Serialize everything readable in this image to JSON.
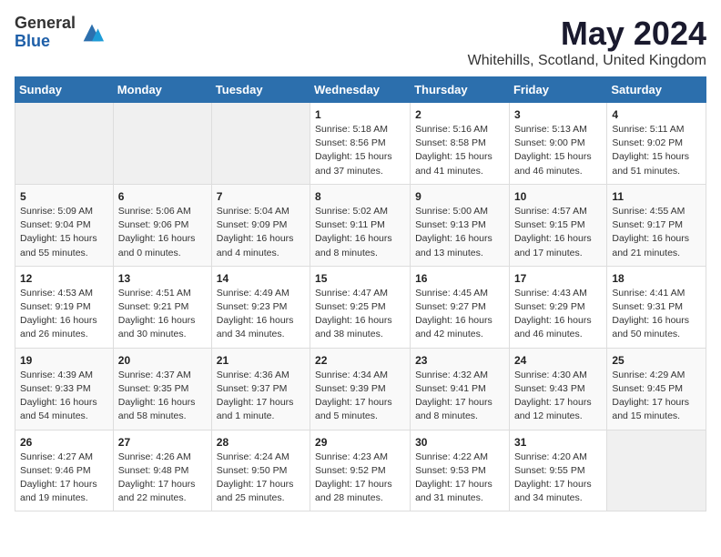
{
  "logo": {
    "general": "General",
    "blue": "Blue"
  },
  "title": "May 2024",
  "location": "Whitehills, Scotland, United Kingdom",
  "weekdays": [
    "Sunday",
    "Monday",
    "Tuesday",
    "Wednesday",
    "Thursday",
    "Friday",
    "Saturday"
  ],
  "weeks": [
    [
      {
        "day": "",
        "info": ""
      },
      {
        "day": "",
        "info": ""
      },
      {
        "day": "",
        "info": ""
      },
      {
        "day": "1",
        "info": "Sunrise: 5:18 AM\nSunset: 8:56 PM\nDaylight: 15 hours\nand 37 minutes."
      },
      {
        "day": "2",
        "info": "Sunrise: 5:16 AM\nSunset: 8:58 PM\nDaylight: 15 hours\nand 41 minutes."
      },
      {
        "day": "3",
        "info": "Sunrise: 5:13 AM\nSunset: 9:00 PM\nDaylight: 15 hours\nand 46 minutes."
      },
      {
        "day": "4",
        "info": "Sunrise: 5:11 AM\nSunset: 9:02 PM\nDaylight: 15 hours\nand 51 minutes."
      }
    ],
    [
      {
        "day": "5",
        "info": "Sunrise: 5:09 AM\nSunset: 9:04 PM\nDaylight: 15 hours\nand 55 minutes."
      },
      {
        "day": "6",
        "info": "Sunrise: 5:06 AM\nSunset: 9:06 PM\nDaylight: 16 hours\nand 0 minutes."
      },
      {
        "day": "7",
        "info": "Sunrise: 5:04 AM\nSunset: 9:09 PM\nDaylight: 16 hours\nand 4 minutes."
      },
      {
        "day": "8",
        "info": "Sunrise: 5:02 AM\nSunset: 9:11 PM\nDaylight: 16 hours\nand 8 minutes."
      },
      {
        "day": "9",
        "info": "Sunrise: 5:00 AM\nSunset: 9:13 PM\nDaylight: 16 hours\nand 13 minutes."
      },
      {
        "day": "10",
        "info": "Sunrise: 4:57 AM\nSunset: 9:15 PM\nDaylight: 16 hours\nand 17 minutes."
      },
      {
        "day": "11",
        "info": "Sunrise: 4:55 AM\nSunset: 9:17 PM\nDaylight: 16 hours\nand 21 minutes."
      }
    ],
    [
      {
        "day": "12",
        "info": "Sunrise: 4:53 AM\nSunset: 9:19 PM\nDaylight: 16 hours\nand 26 minutes."
      },
      {
        "day": "13",
        "info": "Sunrise: 4:51 AM\nSunset: 9:21 PM\nDaylight: 16 hours\nand 30 minutes."
      },
      {
        "day": "14",
        "info": "Sunrise: 4:49 AM\nSunset: 9:23 PM\nDaylight: 16 hours\nand 34 minutes."
      },
      {
        "day": "15",
        "info": "Sunrise: 4:47 AM\nSunset: 9:25 PM\nDaylight: 16 hours\nand 38 minutes."
      },
      {
        "day": "16",
        "info": "Sunrise: 4:45 AM\nSunset: 9:27 PM\nDaylight: 16 hours\nand 42 minutes."
      },
      {
        "day": "17",
        "info": "Sunrise: 4:43 AM\nSunset: 9:29 PM\nDaylight: 16 hours\nand 46 minutes."
      },
      {
        "day": "18",
        "info": "Sunrise: 4:41 AM\nSunset: 9:31 PM\nDaylight: 16 hours\nand 50 minutes."
      }
    ],
    [
      {
        "day": "19",
        "info": "Sunrise: 4:39 AM\nSunset: 9:33 PM\nDaylight: 16 hours\nand 54 minutes."
      },
      {
        "day": "20",
        "info": "Sunrise: 4:37 AM\nSunset: 9:35 PM\nDaylight: 16 hours\nand 58 minutes."
      },
      {
        "day": "21",
        "info": "Sunrise: 4:36 AM\nSunset: 9:37 PM\nDaylight: 17 hours\nand 1 minute."
      },
      {
        "day": "22",
        "info": "Sunrise: 4:34 AM\nSunset: 9:39 PM\nDaylight: 17 hours\nand 5 minutes."
      },
      {
        "day": "23",
        "info": "Sunrise: 4:32 AM\nSunset: 9:41 PM\nDaylight: 17 hours\nand 8 minutes."
      },
      {
        "day": "24",
        "info": "Sunrise: 4:30 AM\nSunset: 9:43 PM\nDaylight: 17 hours\nand 12 minutes."
      },
      {
        "day": "25",
        "info": "Sunrise: 4:29 AM\nSunset: 9:45 PM\nDaylight: 17 hours\nand 15 minutes."
      }
    ],
    [
      {
        "day": "26",
        "info": "Sunrise: 4:27 AM\nSunset: 9:46 PM\nDaylight: 17 hours\nand 19 minutes."
      },
      {
        "day": "27",
        "info": "Sunrise: 4:26 AM\nSunset: 9:48 PM\nDaylight: 17 hours\nand 22 minutes."
      },
      {
        "day": "28",
        "info": "Sunrise: 4:24 AM\nSunset: 9:50 PM\nDaylight: 17 hours\nand 25 minutes."
      },
      {
        "day": "29",
        "info": "Sunrise: 4:23 AM\nSunset: 9:52 PM\nDaylight: 17 hours\nand 28 minutes."
      },
      {
        "day": "30",
        "info": "Sunrise: 4:22 AM\nSunset: 9:53 PM\nDaylight: 17 hours\nand 31 minutes."
      },
      {
        "day": "31",
        "info": "Sunrise: 4:20 AM\nSunset: 9:55 PM\nDaylight: 17 hours\nand 34 minutes."
      },
      {
        "day": "",
        "info": ""
      }
    ]
  ]
}
